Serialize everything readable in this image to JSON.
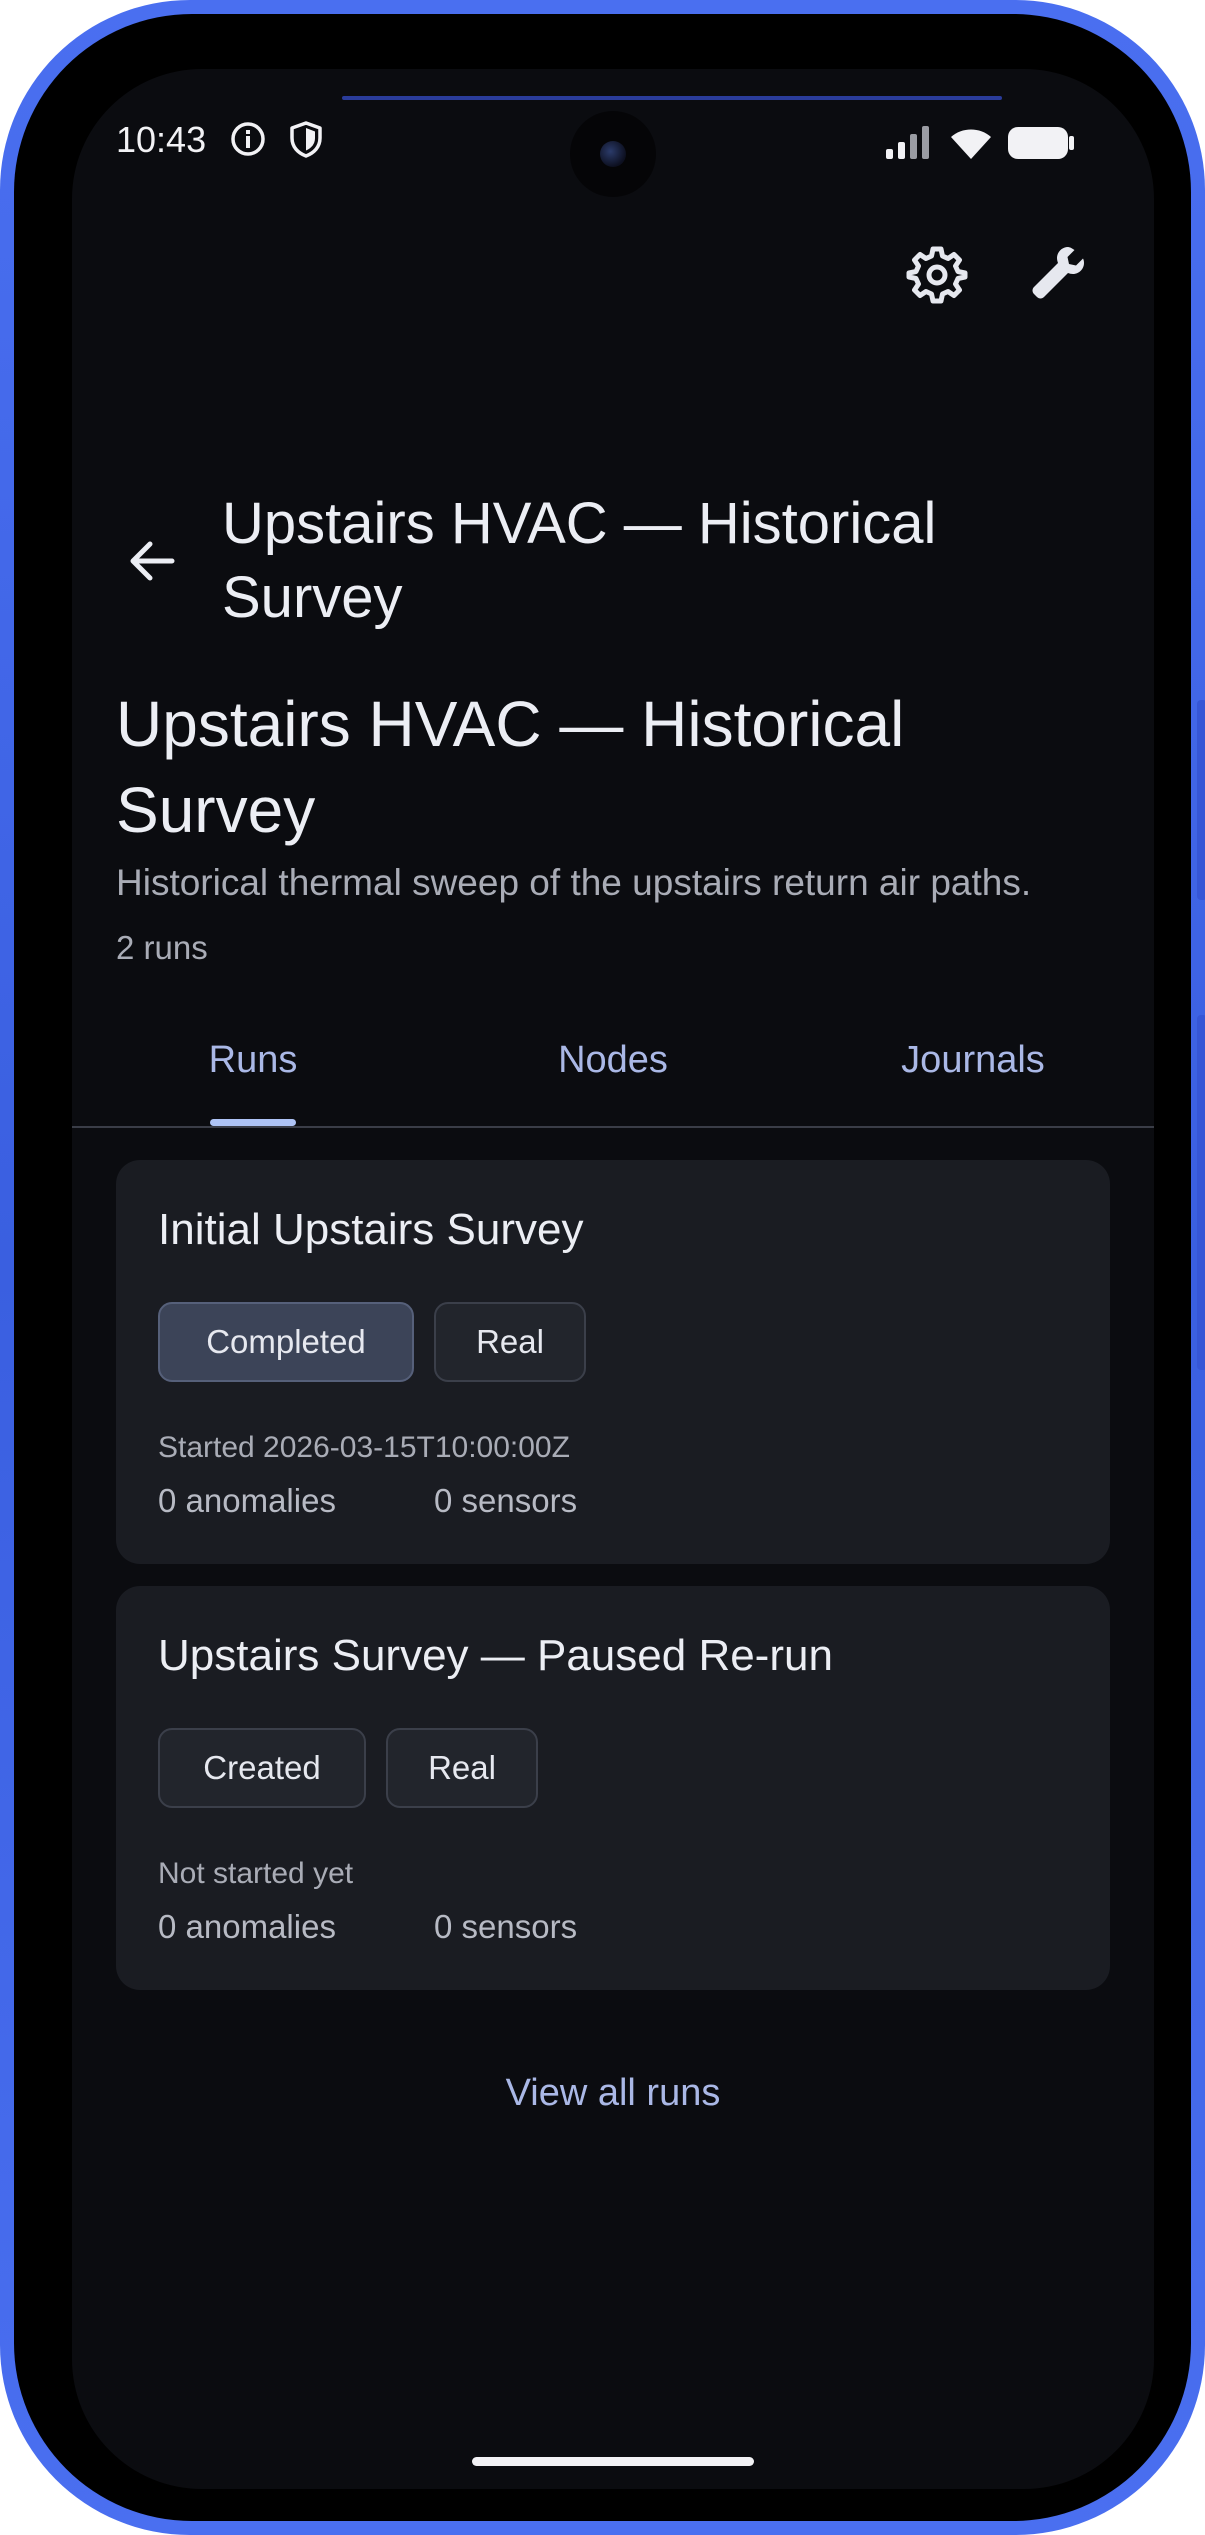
{
  "status_bar": {
    "time": "10:43",
    "icons_left": [
      "info-icon",
      "shield-icon"
    ],
    "icons_right": [
      "signal-icon",
      "wifi-icon",
      "battery-icon"
    ]
  },
  "toolbar": {
    "actions": [
      "gear-icon",
      "wrench-icon"
    ]
  },
  "appbar": {
    "back_icon": "arrow-left-icon",
    "title": "Upstairs HVAC — Historical Survey"
  },
  "header": {
    "title": "Upstairs HVAC — Historical Survey",
    "description": "Historical thermal sweep of the upstairs return air paths.",
    "run_count": "2 runs"
  },
  "tabs": [
    {
      "label": "Runs",
      "selected": true
    },
    {
      "label": "Nodes",
      "selected": false
    },
    {
      "label": "Journals",
      "selected": false
    }
  ],
  "runs": [
    {
      "title": "Initial Upstairs Survey",
      "status": "Completed",
      "mode": "Real",
      "started": "Started 2026-03-15T10:00:00Z",
      "anomalies": "0 anomalies",
      "sensors": "0 sensors"
    },
    {
      "title": "Upstairs Survey — Paused Re-run",
      "status": "Created",
      "mode": "Real",
      "started": "Not started yet",
      "anomalies": "0 anomalies",
      "sensors": "0 sensors"
    }
  ],
  "footer": {
    "view_all_label": "View all runs"
  },
  "colors": {
    "background": "#0b0c10",
    "card": "#1a1c22",
    "accent": "#aec3f5",
    "frame": "#4a6ff0"
  }
}
